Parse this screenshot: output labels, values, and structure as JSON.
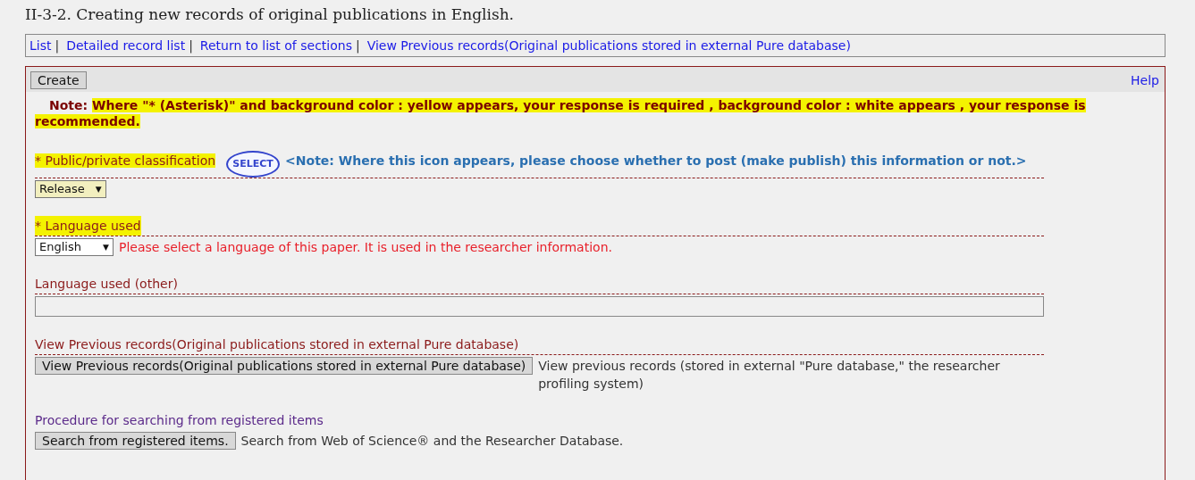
{
  "title": "II-3-2. Creating new records of original publications in English.",
  "nav": [
    {
      "kind": "link",
      "text": "List"
    },
    {
      "kind": "separator",
      "text": "|"
    },
    {
      "kind": "link",
      "text": "Detailed record list"
    },
    {
      "kind": "separator",
      "text": "|"
    },
    {
      "kind": "link",
      "text": "Return to list of sections"
    },
    {
      "kind": "separator",
      "text": "|"
    },
    {
      "kind": "link",
      "text": "View Previous records(Original publications stored in external Pure database)"
    }
  ],
  "toolbar": {
    "create_button": "Create",
    "help_link": "Help"
  },
  "note": {
    "label": "Note:",
    "text": "Where \"* (Asterisk)\" and background color : yellow appears, your response is required , background color : white appears , your response is recommended.",
    "highlighted": true
  },
  "fields": [
    {
      "kind": "select",
      "label": "* Public/private classification",
      "highlighted": true,
      "divider": true,
      "badge": "SELECT",
      "label_note": "<Note: Where this icon appears, please choose whether to post (make publish) this information or not.>",
      "value": "Release",
      "caret": "▼",
      "filled": true
    },
    {
      "kind": "select",
      "label": "* Language used",
      "highlighted": true,
      "divider": true,
      "value": "English",
      "caret": "▼",
      "filled": false,
      "hint": "Please select a language of this paper. It is used in the researcher information."
    },
    {
      "kind": "text",
      "label": "Language used (other)",
      "highlighted": false,
      "divider": true
    },
    {
      "kind": "button",
      "label": "View Previous records(Original publications stored in external Pure database)",
      "highlighted": false,
      "divider": true,
      "button": "View Previous records(Original publications stored in external Pure database)",
      "description": "View previous records (stored in external \"Pure database,\" the researcher profiling system)"
    },
    {
      "kind": "button",
      "label": "Procedure for searching from registered items",
      "highlighted": false,
      "divider": false,
      "button": "Search from registered items.",
      "description": "Search from Web of Science® and the Researcher Database."
    }
  ]
}
